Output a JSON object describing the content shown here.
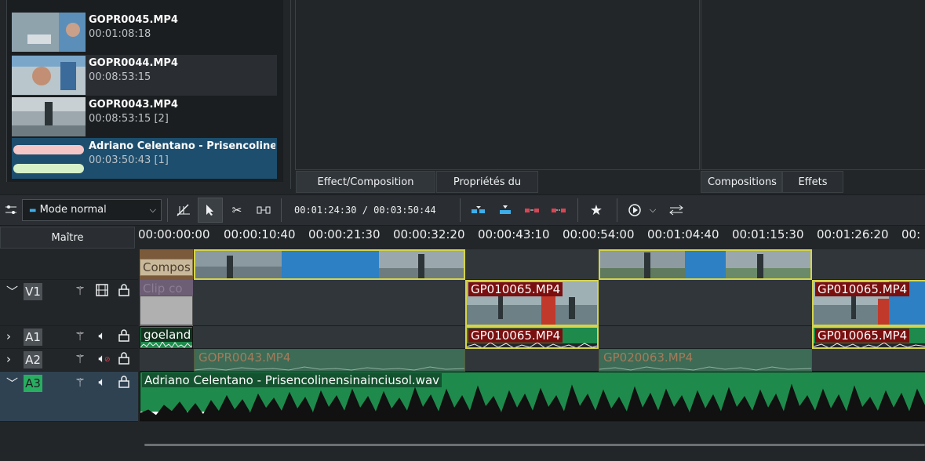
{
  "bin": {
    "items": [
      {
        "name": "GOPR0045.MP4",
        "duration": "00:01:08:18"
      },
      {
        "name": "GOPR0044.MP4",
        "duration": "00:08:53:15"
      },
      {
        "name": "GOPR0043.MP4",
        "duration": "00:08:53:15 [2]"
      },
      {
        "name": "Adriano Celentano - Prisencolinensinainciusol.wav",
        "duration": "00:03:50:43 [1]"
      }
    ]
  },
  "tabs": {
    "stack": "Effect/Composition Stack",
    "clip_props": "Propriétés du clip",
    "compositions": "Compositions",
    "effects": "Effets"
  },
  "toolbar": {
    "mode": "Mode normal",
    "timecode": "00:01:24:30 / 00:03:50:44",
    "icons": [
      "track-config-icon",
      "razor-snap-icon",
      "select-tool-icon",
      "cut-tool-icon",
      "spacer-tool-icon",
      "insert-icon",
      "overwrite-icon",
      "lift-icon",
      "extract-icon",
      "favorite-icon",
      "record-icon",
      "mixer-icon"
    ]
  },
  "timeline": {
    "master": "Maître",
    "ruler": [
      "00:00:00:00",
      "00:00:10:40",
      "00:00:21:30",
      "00:00:32:20",
      "00:00:43:10",
      "00:00:54:00",
      "00:01:04:40",
      "00:01:15:30",
      "00:01:26:20",
      "00:"
    ],
    "tracks": [
      {
        "name": "V1"
      },
      {
        "name": "A1"
      },
      {
        "name": "A2"
      },
      {
        "name": "A3"
      }
    ],
    "clips": {
      "composition": "Compos",
      "clip_color": "Clip co",
      "gp010065_v1": "GP010065.MP4",
      "gp010065_v2": "GP010065.MP4",
      "goeland": "goeland",
      "gp010065_a1": "GP010065.MP4",
      "gp010065_a2": "GP010065.MP4",
      "gopr0043_a2": "GOPR0043.MP4",
      "gp020063_a2": "GP020063.MP4",
      "celentano_a3": "Adriano Celentano - Prisencolinensinainciusol.wav"
    }
  },
  "colors": {
    "audio_green": "#1e8b4c",
    "audio_dim": "#3d6b56",
    "label_red": "#7a0f0f",
    "clip_yellow": "#d4d44a",
    "selection_blue": "#1d4e6e"
  }
}
